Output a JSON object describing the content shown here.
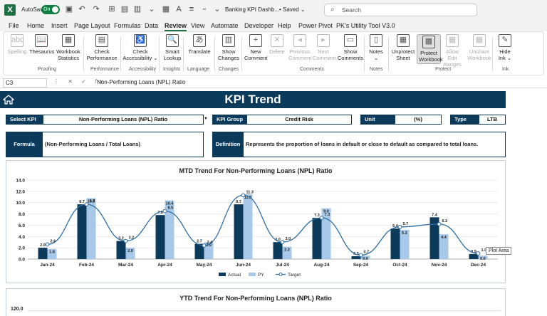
{
  "titlebar": {
    "logo": "X",
    "autosave_label": "AutoSave",
    "autosave_state": "On",
    "doc_title": "Banking KPI Dashb...",
    "saved_state": "• Saved ⌄",
    "search_placeholder": "Search"
  },
  "menu": [
    "File",
    "Home",
    "Insert",
    "Page Layout",
    "Formulas",
    "Data",
    "Review",
    "View",
    "Automate",
    "Developer",
    "Help",
    "Power Pivot",
    "PK's Utility Tool V3.0"
  ],
  "ribbon": {
    "buttons": [
      {
        "label": "Spelling",
        "icon": "abc",
        "disabled": true
      },
      {
        "label": "Thesaurus",
        "icon": "📖",
        "disabled": false
      },
      {
        "label": "Workbook\nStatistics",
        "icon": "▦",
        "disabled": false
      },
      {
        "label": "Check\nPerformance",
        "icon": "▤",
        "disabled": false
      },
      {
        "label": "Check\nAccessibility ⌄",
        "icon": "♿",
        "disabled": false
      },
      {
        "label": "Smart\nLookup",
        "icon": "🔍",
        "disabled": false
      },
      {
        "label": "Translate",
        "icon": "あ",
        "disabled": false
      },
      {
        "label": "Show\nChanges",
        "icon": "▥",
        "disabled": false
      },
      {
        "label": "New\nComment",
        "icon": "+",
        "disabled": false
      },
      {
        "label": "Delete",
        "icon": "✕",
        "disabled": true
      },
      {
        "label": "Previous\nComment",
        "icon": "◂",
        "disabled": true
      },
      {
        "label": "Next\nComment",
        "icon": "▸",
        "disabled": true
      },
      {
        "label": "Show\nComments",
        "icon": "▭",
        "disabled": false
      },
      {
        "label": "Notes\n⌄",
        "icon": "▯",
        "disabled": false
      },
      {
        "label": "Unprotect\nSheet",
        "icon": "▦",
        "disabled": false
      },
      {
        "label": "Protect\nWorkbook",
        "icon": "▦",
        "disabled": false
      },
      {
        "label": "Allow Edit\nRanges",
        "icon": "▦",
        "disabled": true
      },
      {
        "label": "Unshare\nWorkbook",
        "icon": "▦",
        "disabled": true
      },
      {
        "label": "Hide\nInk ⌄",
        "icon": "✎",
        "disabled": false
      }
    ],
    "groups": [
      "Proofing",
      "Performance",
      "Accessibility",
      "Insights",
      "Language",
      "Changes",
      "Comments",
      "Notes",
      "Protect",
      "Ink"
    ]
  },
  "formula_bar": {
    "cell": "C3",
    "content": "Non-Performing Loans (NPL) Ratio"
  },
  "dashboard": {
    "title": "KPI Trend",
    "select_kpi_label": "Select KPI",
    "select_kpi_value": "Non-Performing Loans (NPL) Ratio",
    "kpi_group_label": "KPI Group",
    "kpi_group_value": "Credit Risk",
    "unit_label": "Unit",
    "unit_value": "(%)",
    "type_label": "Type",
    "type_value": "LTB",
    "formula_label": "Formula",
    "formula_value": "(Non-Performing Loans / Total Loans)",
    "definition_label": "Definition",
    "definition_value": "Represents the proportion of loans in default or close to default as compared to total loans.",
    "tooltip": "Plot Area",
    "ytd_title": "YTD Trend For Non-Performing Loans (NPL) Ratio",
    "ytd_first_tick": "120.0"
  },
  "chart_data": {
    "type": "bar",
    "title": "MTD Trend For Non-Performing Loans (NPL) Ratio",
    "categories": [
      "Jan-24",
      "Feb-24",
      "Mar-24",
      "Apr-24",
      "May-24",
      "Jun-24",
      "Jul-24",
      "Aug-24",
      "Sep-24",
      "Oct-24",
      "Nov-24",
      "Dec-24"
    ],
    "series": [
      {
        "name": "Actual",
        "type": "bar",
        "color": "#0b3a5b",
        "values": [
          2.0,
          9.7,
          3.2,
          7.8,
          2.7,
          9.7,
          3.0,
          7.3,
          0.5,
          5.4,
          7.4,
          0.9
        ]
      },
      {
        "name": "PY",
        "type": "bar",
        "color": "#a7c8e8",
        "values": [
          1.8,
          10.8,
          2.0,
          10.4,
          3.0,
          11.5,
          2.2,
          9.0,
          0.6,
          5.2,
          4.4,
          0.6
        ]
      },
      {
        "name": "Target",
        "type": "line",
        "color": "#2e6da4",
        "values": [
          2.6,
          9.7,
          3.2,
          8.5,
          2.4,
          11.3,
          3.0,
          7.3,
          0.7,
          5.7,
          6.2,
          1.0
        ]
      }
    ],
    "ylim": [
      0,
      14
    ],
    "yticks": [
      "0.0",
      "2.0",
      "4.0",
      "6.0",
      "8.0",
      "10.0",
      "12.0",
      "14.0"
    ],
    "legend": "bottom"
  }
}
